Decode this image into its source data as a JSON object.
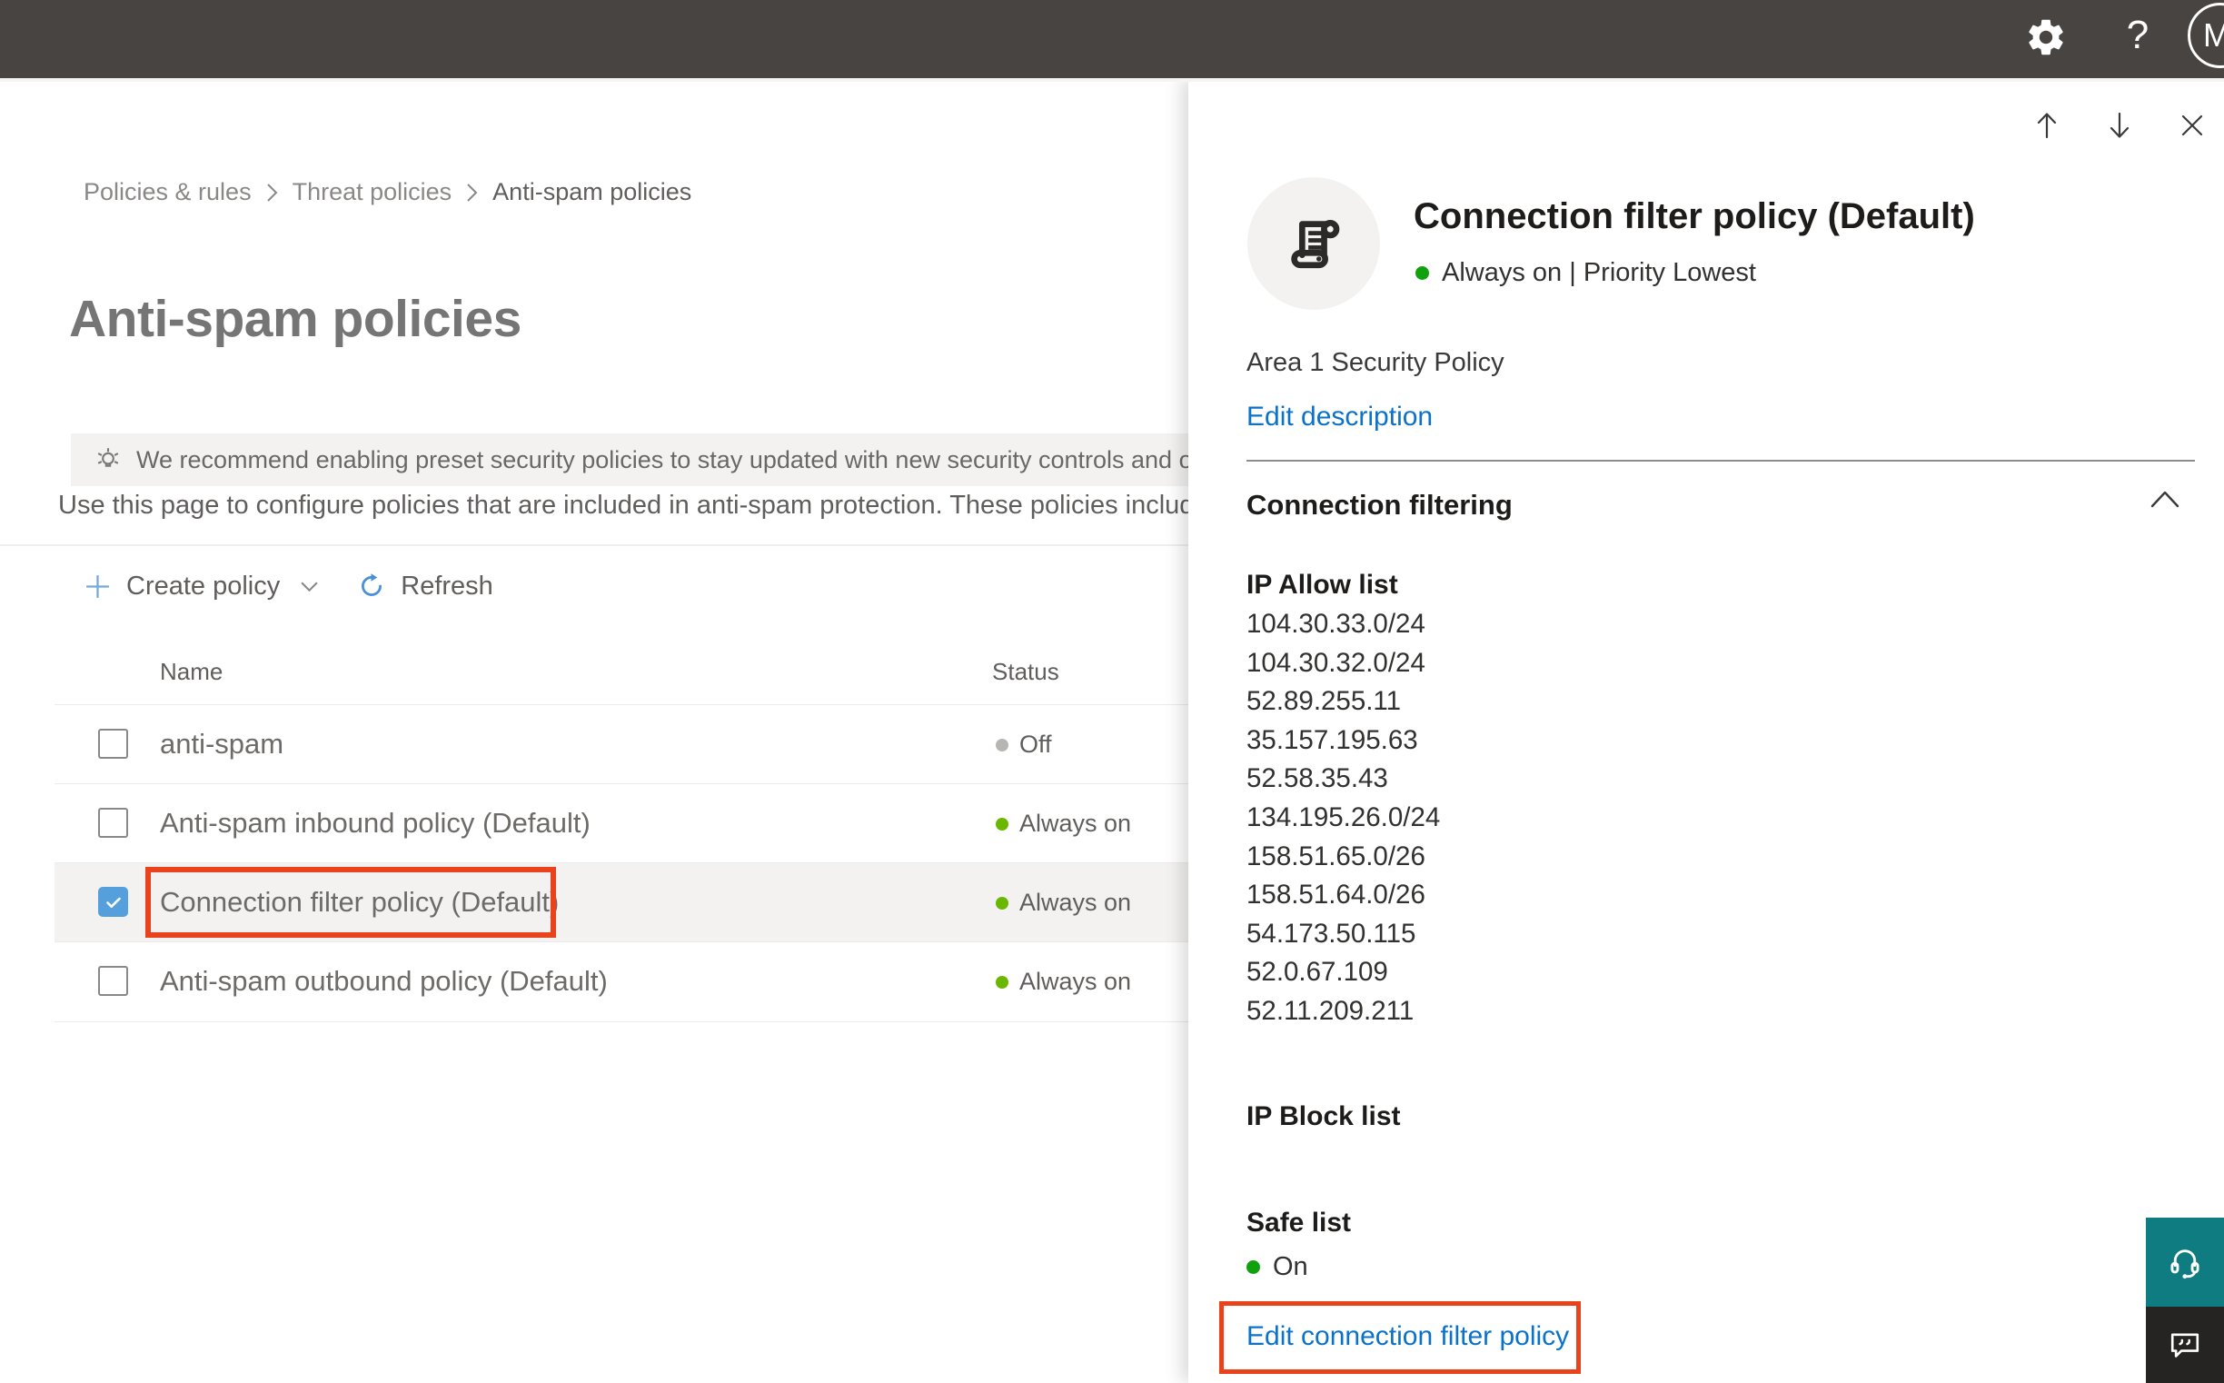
{
  "topbar": {
    "help_label": "?",
    "avatar_initial": "M"
  },
  "breadcrumb": {
    "items": [
      "Policies & rules",
      "Threat policies",
      "Anti-spam policies"
    ]
  },
  "page": {
    "title": "Anti-spam policies",
    "banner_text": "We recommend enabling preset security policies to stay updated with new security controls and our recomme",
    "description": "Use this page to configure policies that are included in anti-spam protection. These policies include",
    "toolbar": {
      "create_policy_label": "Create policy",
      "refresh_label": "Refresh"
    }
  },
  "table": {
    "columns": {
      "name": "Name",
      "status": "Status"
    },
    "rows": [
      {
        "name": "anti-spam",
        "status": "Off"
      },
      {
        "name": "Anti-spam inbound policy (Default)",
        "status": "Always on"
      },
      {
        "name": "Connection filter policy (Default)",
        "status": "Always on"
      },
      {
        "name": "Anti-spam outbound policy (Default)",
        "status": "Always on"
      }
    ]
  },
  "panel": {
    "title": "Connection filter policy (Default)",
    "status_line": "Always on | Priority Lowest",
    "description": "Area 1 Security Policy",
    "edit_description_label": "Edit description",
    "section": {
      "title": "Connection filtering"
    },
    "ip_allow": {
      "title": "IP Allow list",
      "items": [
        "104.30.33.0/24",
        "104.30.32.0/24",
        "52.89.255.11",
        "35.157.195.63",
        "52.58.35.43",
        "134.195.26.0/24",
        "158.51.65.0/26",
        "158.51.64.0/26",
        "54.173.50.115",
        "52.0.67.109",
        "52.11.209.211"
      ]
    },
    "ip_block": {
      "title": "IP Block list"
    },
    "safe_list": {
      "title": "Safe list",
      "status": "On"
    },
    "edit_policy_label": "Edit connection filter policy"
  },
  "colors": {
    "accent_blue": "#0b72c9",
    "panel_status_green": "#12a10e",
    "table_status_green": "#6bb700",
    "status_gray": "#b8b6b3",
    "highlight_red": "#e8431c",
    "support_teal": "#0e7c80",
    "feedback_dark": "#252423",
    "topbar_dark": "#474441"
  }
}
